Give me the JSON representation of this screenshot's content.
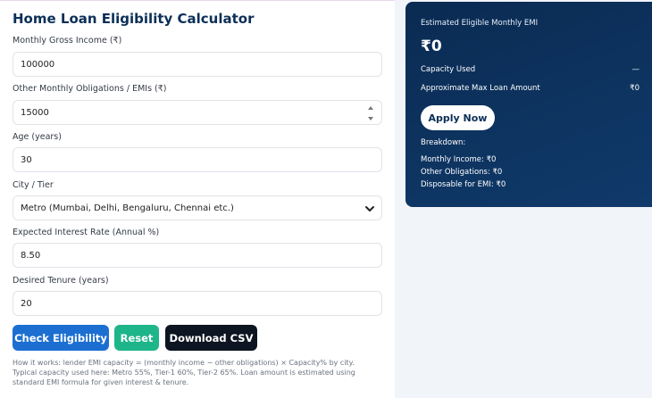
{
  "form": {
    "title": "Home Loan Eligibility Calculator",
    "income": {
      "label": "Monthly Gross Income (₹)",
      "value": "100000"
    },
    "obligations": {
      "label": "Other Monthly Obligations / EMIs (₹)",
      "value": "15000"
    },
    "age": {
      "label": "Age (years)",
      "value": "30"
    },
    "city": {
      "label": "City / Tier",
      "value": "Metro (Mumbai, Delhi, Bengaluru, Chennai etc.)"
    },
    "rate": {
      "label": "Expected Interest Rate (Annual %)",
      "value": "8.50"
    },
    "tenure": {
      "label": "Desired Tenure (years)",
      "value": "20"
    }
  },
  "actions": {
    "check_label": "Check Eligibility",
    "reset_label": "Reset",
    "csv_label": "Download CSV"
  },
  "howto": "How it works: lender EMI capacity = (monthly income − other obligations) × Capacity% by city. Typical capacity used here: Metro 55%, Tier-1 60%, Tier-2 65%. Loan amount is estimated using standard EMI formula for given interest & tenure.",
  "result": {
    "heading": "Estimated Eligible Monthly EMI",
    "emi": "₹0",
    "capacity_label": "Capacity Used",
    "capacity_value": "—",
    "maxloan_label": "Approximate Max Loan Amount",
    "maxloan_value": "₹0",
    "apply_label": "Apply Now",
    "breakdown_label": "Breakdown:",
    "monthly_income": "Monthly Income: ₹0",
    "other_obligations": "Other Obligations: ₹0",
    "disposable": "Disposable for EMI: ₹0"
  },
  "colors": {
    "primary": "#1c6fd1",
    "success": "#1fb58a",
    "dark": "#0d1522",
    "card": "#0a2b52"
  }
}
